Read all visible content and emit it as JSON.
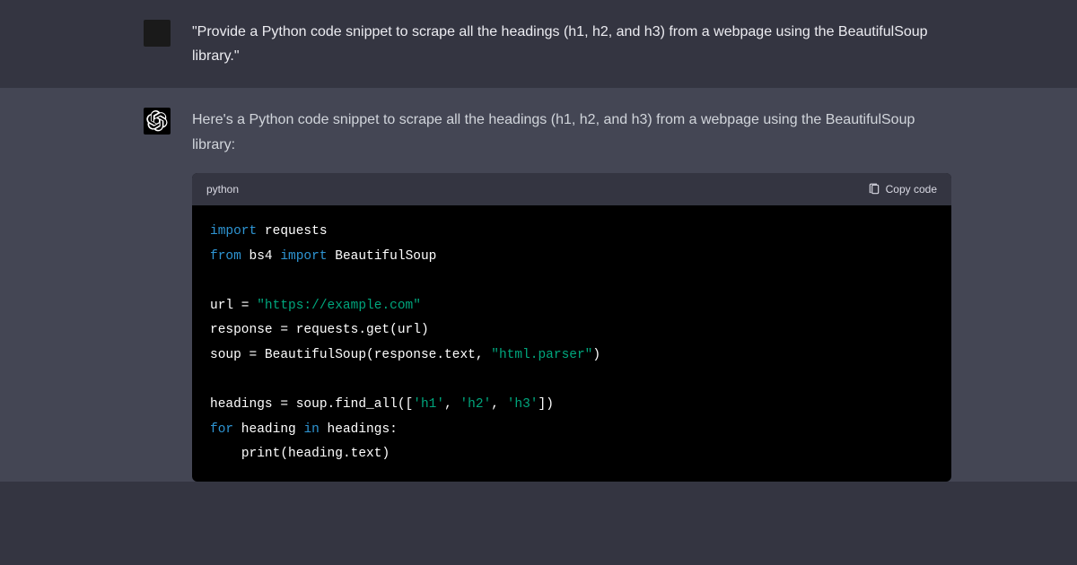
{
  "user": {
    "text": "\"Provide a Python code snippet to scrape all the headings (h1, h2, and h3) from a webpage using the BeautifulSoup library.\""
  },
  "assistant": {
    "text": "Here's a Python code snippet to scrape all the headings (h1, h2, and h3) from a webpage using the BeautifulSoup library:"
  },
  "code": {
    "language": "python",
    "copy_label": "Copy code",
    "tokens": {
      "import1": "import",
      "requests": "requests",
      "from": "from",
      "bs4": "bs4",
      "import2": "import",
      "BeautifulSoup": "BeautifulSoup",
      "url_var": "url = ",
      "url_str": "\"https://example.com\"",
      "response_line": "response = requests.get(url)",
      "soup_line1": "soup = BeautifulSoup(response.text, ",
      "parser_str": "\"html.parser\"",
      "soup_line2": ")",
      "headings_line1": "headings = soup.find_all([",
      "h1": "'h1'",
      "comma1": ", ",
      "h2": "'h2'",
      "comma2": ", ",
      "h3": "'h3'",
      "headings_line2": "])",
      "for": "for",
      "for_mid": " heading ",
      "in": "in",
      "for_end": " headings:",
      "print": "print",
      "print_args": "(heading.text)"
    }
  }
}
